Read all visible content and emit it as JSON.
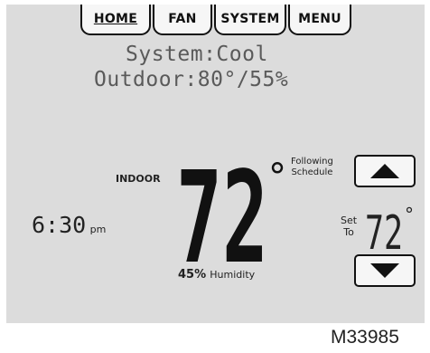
{
  "tabs": {
    "home": "HOME",
    "fan": "FAN",
    "system": "SYSTEM",
    "menu": "MENU"
  },
  "status": {
    "system_line": "System:Cool",
    "outdoor_line": "Outdoor:80°/55%"
  },
  "indoor": {
    "label": "INDOOR",
    "temperature": "72",
    "degree": "°",
    "humidity_value": "45%",
    "humidity_label": "Humidity"
  },
  "clock": {
    "time": "6:30",
    "ampm": "pm"
  },
  "schedule": {
    "line1": "Following",
    "line2": "Schedule"
  },
  "setpoint": {
    "label_line1": "Set",
    "label_line2": "To",
    "value": "72",
    "degree": "°"
  },
  "icons": {
    "up": "triangle-up-icon",
    "down": "triangle-down-icon"
  },
  "colors": {
    "screen": "#dcdcdc",
    "button": "#f6f6f6",
    "outline": "#111111",
    "lcd_text": "#5a5a5a"
  },
  "figure_id": "M33985"
}
